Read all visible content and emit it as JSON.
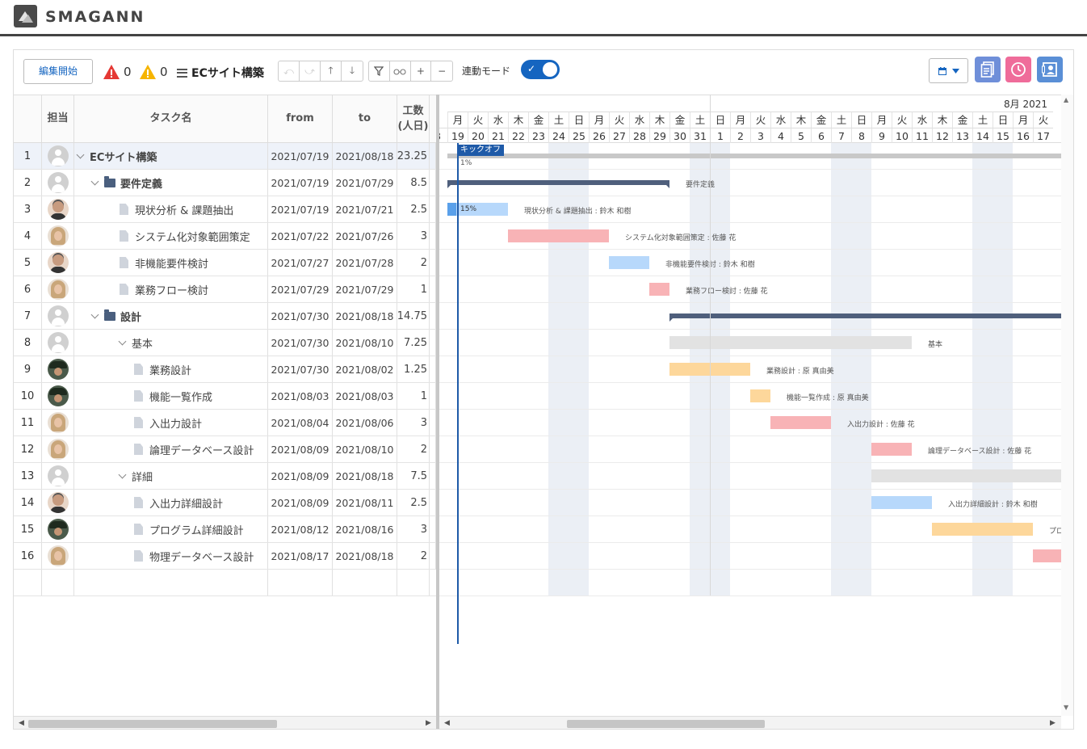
{
  "app": {
    "brand": "SMAGANN"
  },
  "toolbar": {
    "edit_label": "編集開始",
    "error_count": "0",
    "warning_count": "0",
    "project_title": "ECサイト構築",
    "link_mode_label": "連動モード",
    "link_mode_on": true
  },
  "grid": {
    "headers": {
      "assignee": "担当",
      "task": "タスク名",
      "from": "from",
      "to": "to",
      "effort": "工数\n(人日)"
    },
    "rows": [
      {
        "no": "1",
        "avatar": "empty",
        "level": 0,
        "type": "root",
        "name": "ECサイト構築",
        "from": "2021/07/19",
        "to": "2021/08/18",
        "effort": "23.25"
      },
      {
        "no": "2",
        "avatar": "empty",
        "level": 1,
        "type": "folder",
        "name": "要件定義",
        "from": "2021/07/19",
        "to": "2021/07/29",
        "effort": "8.5"
      },
      {
        "no": "3",
        "avatar": "man",
        "level": 2,
        "type": "task",
        "name": "現状分析 & 課題抽出",
        "from": "2021/07/19",
        "to": "2021/07/21",
        "effort": "2.5"
      },
      {
        "no": "4",
        "avatar": "woman",
        "level": 2,
        "type": "task",
        "name": "システム化対象範囲策定",
        "from": "2021/07/22",
        "to": "2021/07/26",
        "effort": "3"
      },
      {
        "no": "5",
        "avatar": "man",
        "level": 2,
        "type": "task",
        "name": "非機能要件検討",
        "from": "2021/07/27",
        "to": "2021/07/28",
        "effort": "2"
      },
      {
        "no": "6",
        "avatar": "woman",
        "level": 2,
        "type": "task",
        "name": "業務フロー検討",
        "from": "2021/07/29",
        "to": "2021/07/29",
        "effort": "1"
      },
      {
        "no": "7",
        "avatar": "empty",
        "level": 1,
        "type": "folder",
        "name": "設計",
        "from": "2021/07/30",
        "to": "2021/08/18",
        "effort": "14.75"
      },
      {
        "no": "8",
        "avatar": "empty",
        "level": 2,
        "type": "group",
        "name": "基本",
        "from": "2021/07/30",
        "to": "2021/08/10",
        "effort": "7.25"
      },
      {
        "no": "9",
        "avatar": "hat",
        "level": 3,
        "type": "task",
        "name": "業務設計",
        "from": "2021/07/30",
        "to": "2021/08/02",
        "effort": "1.25"
      },
      {
        "no": "10",
        "avatar": "hat",
        "level": 3,
        "type": "task",
        "name": "機能一覧作成",
        "from": "2021/08/03",
        "to": "2021/08/03",
        "effort": "1"
      },
      {
        "no": "11",
        "avatar": "woman",
        "level": 3,
        "type": "task",
        "name": "入出力設計",
        "from": "2021/08/04",
        "to": "2021/08/06",
        "effort": "3"
      },
      {
        "no": "12",
        "avatar": "woman",
        "level": 3,
        "type": "task",
        "name": "論理データベース設計",
        "from": "2021/08/09",
        "to": "2021/08/10",
        "effort": "2"
      },
      {
        "no": "13",
        "avatar": "empty",
        "level": 2,
        "type": "group",
        "name": "詳細",
        "from": "2021/08/09",
        "to": "2021/08/18",
        "effort": "7.5"
      },
      {
        "no": "14",
        "avatar": "man",
        "level": 3,
        "type": "task",
        "name": "入出力詳細設計",
        "from": "2021/08/09",
        "to": "2021/08/11",
        "effort": "2.5"
      },
      {
        "no": "15",
        "avatar": "hat",
        "level": 3,
        "type": "task",
        "name": "プログラム詳細設計",
        "from": "2021/08/12",
        "to": "2021/08/16",
        "effort": "3"
      },
      {
        "no": "16",
        "avatar": "woman",
        "level": 3,
        "type": "task",
        "name": "物理データベース設計",
        "from": "2021/08/17",
        "to": "2021/08/18",
        "effort": "2"
      }
    ]
  },
  "gantt": {
    "month_label": "8月 2021",
    "partial_first_day": "8",
    "dows": [
      "月",
      "火",
      "水",
      "木",
      "金",
      "土",
      "日",
      "月",
      "火",
      "水",
      "木",
      "金",
      "土",
      "日",
      "月",
      "火",
      "水",
      "木",
      "金",
      "土",
      "日",
      "月",
      "火",
      "水",
      "木",
      "金",
      "土",
      "日",
      "月",
      "火"
    ],
    "days": [
      "19",
      "20",
      "21",
      "22",
      "23",
      "24",
      "25",
      "26",
      "27",
      "28",
      "29",
      "30",
      "31",
      "1",
      "2",
      "3",
      "4",
      "5",
      "6",
      "7",
      "8",
      "9",
      "10",
      "11",
      "12",
      "13",
      "14",
      "15",
      "16",
      "17"
    ],
    "milestone_label": "キックオフ",
    "root_progress": "1%",
    "bars": [
      {
        "row": 1,
        "start": 0,
        "len": 30.5,
        "kind": "summary-gray",
        "label": "",
        "progress": ""
      },
      {
        "row": 2,
        "start": 0,
        "len": 11,
        "kind": "summary-dark",
        "label": "要件定義",
        "progress": ""
      },
      {
        "row": 3,
        "start": 0,
        "len": 3,
        "kind": "blue",
        "label": "現状分析 & 課題抽出 : 鈴木 和樹",
        "progress": "15%"
      },
      {
        "row": 4,
        "start": 3,
        "len": 5,
        "kind": "red",
        "label": "システム化対象範囲策定 : 佐藤 花",
        "progress": ""
      },
      {
        "row": 5,
        "start": 8,
        "len": 2,
        "kind": "blue",
        "label": "非機能要件検討 : 鈴木 和樹",
        "progress": ""
      },
      {
        "row": 6,
        "start": 10,
        "len": 1,
        "kind": "red",
        "label": "業務フロー検討 : 佐藤 花",
        "progress": ""
      },
      {
        "row": 7,
        "start": 11,
        "len": 20,
        "kind": "summary-dark",
        "label": "",
        "progress": ""
      },
      {
        "row": 8,
        "start": 11,
        "len": 12,
        "kind": "group-gray",
        "label": "基本",
        "progress": ""
      },
      {
        "row": 9,
        "start": 11,
        "len": 4,
        "kind": "orange",
        "label": "業務設計 : 原 真由美",
        "progress": ""
      },
      {
        "row": 10,
        "start": 15,
        "len": 1,
        "kind": "orange",
        "label": "機能一覧作成 : 原 真由美",
        "progress": ""
      },
      {
        "row": 11,
        "start": 16,
        "len": 3,
        "kind": "red",
        "label": "入出力設計 : 佐藤 花",
        "progress": ""
      },
      {
        "row": 12,
        "start": 21,
        "len": 2,
        "kind": "red",
        "label": "論理データベース設計 : 佐藤 花",
        "progress": ""
      },
      {
        "row": 13,
        "start": 21,
        "len": 10,
        "kind": "group-gray",
        "label": "",
        "progress": ""
      },
      {
        "row": 14,
        "start": 21,
        "len": 3,
        "kind": "blue",
        "label": "入出力詳細設計 : 鈴木 和樹",
        "progress": ""
      },
      {
        "row": 15,
        "start": 24,
        "len": 5,
        "kind": "orange",
        "label": "プロ",
        "progress": ""
      },
      {
        "row": 16,
        "start": 29,
        "len": 2,
        "kind": "red",
        "label": "",
        "progress": ""
      }
    ]
  },
  "colors": {
    "accent": "#1565c0",
    "blue_bar": "#b7d8fb",
    "blue_progress": "#5aa0ea",
    "red_bar": "#f8b3b6",
    "orange_bar": "#fdd79b",
    "summary_dark": "#4f5f7c",
    "summary_gray": "#c8c8c8",
    "group_gray": "#e2e2e2",
    "icon_doc": "#6f8fd9",
    "icon_clock": "#ef6c9a",
    "icon_person": "#5a8fd6"
  },
  "icons": {
    "error": "warning-triangle-red",
    "warning": "warning-triangle-yellow",
    "undo": "undo-icon",
    "redo": "redo-icon",
    "up": "arrow-up-icon",
    "down": "arrow-down-icon",
    "filter": "filter-icon",
    "glasses": "glasses-icon",
    "plus": "plus-icon",
    "minus": "minus-icon",
    "calendar": "calendar-icon",
    "doc": "document-icon",
    "clock": "clock-icon",
    "person": "person-card-icon"
  }
}
